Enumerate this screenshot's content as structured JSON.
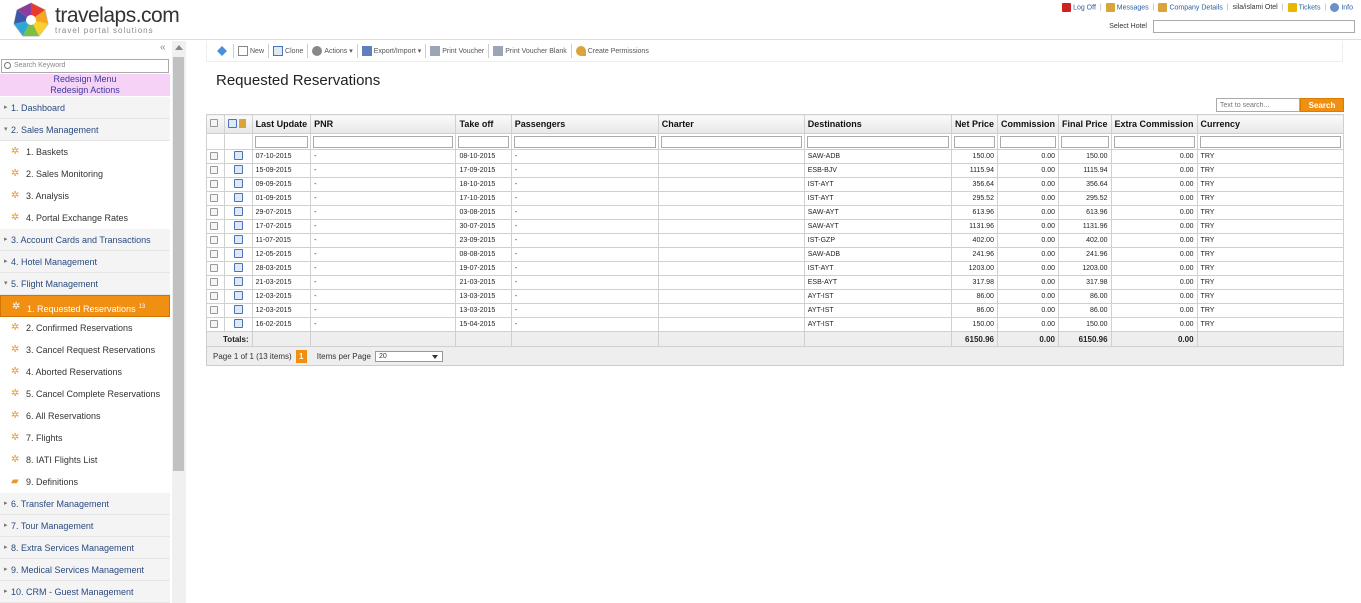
{
  "brand": {
    "name": "travelaps.com",
    "tagline": "travel portal solutions"
  },
  "toplinks": [
    {
      "label": "Log Off",
      "icon": "logoff-icon",
      "color": "#cc2222"
    },
    {
      "label": "Messages",
      "icon": "messages-icon",
      "color": "#d9a53a"
    },
    {
      "label": "Company Details",
      "icon": "company-icon",
      "color": "#d9a53a"
    },
    {
      "label": "sila/islami Otel",
      "icon": "",
      "color": ""
    },
    {
      "label": "Tickets",
      "icon": "tickets-icon",
      "color": "#e8b800"
    },
    {
      "label": "Info",
      "icon": "info-icon",
      "color": "#6b8fc9"
    }
  ],
  "select_hotel_label": "Select Hotel",
  "sidebar": {
    "search_placeholder": "Search Keyword",
    "redesign_menu": "Redesign Menu",
    "redesign_actions": "Redesign Actions",
    "items": [
      {
        "label": "1. Dashboard",
        "level": 1
      },
      {
        "label": "2. Sales Management",
        "level": 1,
        "open": true
      },
      {
        "label": "1. Baskets",
        "level": 2
      },
      {
        "label": "2. Sales Monitoring",
        "level": 2
      },
      {
        "label": "3. Analysis",
        "level": 2
      },
      {
        "label": "4. Portal Exchange Rates",
        "level": 2
      },
      {
        "label": "3. Account Cards and Transactions",
        "level": 1
      },
      {
        "label": "4. Hotel Management",
        "level": 1
      },
      {
        "label": "5. Flight Management",
        "level": 1,
        "open": true
      },
      {
        "label": "1. Requested Reservations",
        "level": 2,
        "active": true,
        "badge": "13"
      },
      {
        "label": "2. Confirmed Reservations",
        "level": 2
      },
      {
        "label": "3. Cancel Request Reservations",
        "level": 2
      },
      {
        "label": "4. Aborted Reservations",
        "level": 2
      },
      {
        "label": "5. Cancel Complete Reservations",
        "level": 2
      },
      {
        "label": "6. All Reservations",
        "level": 2
      },
      {
        "label": "7. Flights",
        "level": 2
      },
      {
        "label": "8. IATI Flights List",
        "level": 2
      },
      {
        "label": "9. Definitions",
        "level": 2
      },
      {
        "label": "6. Transfer Management",
        "level": 1
      },
      {
        "label": "7. Tour Management",
        "level": 1
      },
      {
        "label": "8. Extra Services Management",
        "level": 1
      },
      {
        "label": "9. Medical Services Management",
        "level": 1
      },
      {
        "label": "10. CRM - Guest Management",
        "level": 1
      }
    ]
  },
  "toolbar": {
    "new": "New",
    "clone": "Clone",
    "actions": "Actions",
    "export_import": "Export/Import",
    "print_voucher": "Print Voucher",
    "print_voucher_blank": "Print Voucher Blank",
    "create_permissions": "Create Permissions"
  },
  "page_title": "Requested Reservations",
  "search": {
    "placeholder": "Text to search...",
    "button": "Search"
  },
  "table": {
    "columns": [
      "Last Update",
      "PNR",
      "Take off",
      "Passengers",
      "Charter",
      "Destinations",
      "Net Price",
      "Commission",
      "Final Price",
      "Extra Commission",
      "Currency"
    ],
    "rows": [
      [
        "07-10-2015",
        "-",
        "08-10-2015",
        "-",
        "",
        "SAW-ADB",
        "150.00",
        "0.00",
        "150.00",
        "0.00",
        "TRY"
      ],
      [
        "15-09-2015",
        "-",
        "17-09-2015",
        "-",
        "",
        "ESB-BJV",
        "1115.94",
        "0.00",
        "1115.94",
        "0.00",
        "TRY"
      ],
      [
        "09-09-2015",
        "-",
        "18-10-2015",
        "-",
        "",
        "IST-AYT",
        "356.64",
        "0.00",
        "356.64",
        "0.00",
        "TRY"
      ],
      [
        "01-09-2015",
        "-",
        "17-10-2015",
        "-",
        "",
        "IST-AYT",
        "295.52",
        "0.00",
        "295.52",
        "0.00",
        "TRY"
      ],
      [
        "29-07-2015",
        "-",
        "03-08-2015",
        "-",
        "",
        "SAW-AYT",
        "613.96",
        "0.00",
        "613.96",
        "0.00",
        "TRY"
      ],
      [
        "17-07-2015",
        "-",
        "30-07-2015",
        "-",
        "",
        "SAW-AYT",
        "1131.96",
        "0.00",
        "1131.96",
        "0.00",
        "TRY"
      ],
      [
        "11-07-2015",
        "-",
        "23-09-2015",
        "-",
        "",
        "IST-GZP",
        "402.00",
        "0.00",
        "402.00",
        "0.00",
        "TRY"
      ],
      [
        "12-05-2015",
        "-",
        "08-08-2015",
        "-",
        "",
        "SAW-ADB",
        "241.96",
        "0.00",
        "241.96",
        "0.00",
        "TRY"
      ],
      [
        "28-03-2015",
        "-",
        "19-07-2015",
        "-",
        "",
        "IST-AYT",
        "1203.00",
        "0.00",
        "1203.00",
        "0.00",
        "TRY"
      ],
      [
        "21-03-2015",
        "-",
        "21-03-2015",
        "-",
        "",
        "ESB-AYT",
        "317.98",
        "0.00",
        "317.98",
        "0.00",
        "TRY"
      ],
      [
        "12-03-2015",
        "-",
        "13-03-2015",
        "-",
        "",
        "AYT-IST",
        "86.00",
        "0.00",
        "86.00",
        "0.00",
        "TRY"
      ],
      [
        "12-03-2015",
        "-",
        "13-03-2015",
        "-",
        "",
        "AYT-IST",
        "86.00",
        "0.00",
        "86.00",
        "0.00",
        "TRY"
      ],
      [
        "16-02-2015",
        "-",
        "15-04-2015",
        "-",
        "",
        "AYT-IST",
        "150.00",
        "0.00",
        "150.00",
        "0.00",
        "TRY"
      ]
    ],
    "totals_label": "Totals:",
    "totals": {
      "net_price": "6150.96",
      "commission": "0.00",
      "final_price": "6150.96",
      "extra_commission": "0.00"
    }
  },
  "pager": {
    "info": "Page 1 of 1 (13 items)",
    "current_page": "1",
    "items_per_page_label": "Items per Page",
    "items_per_page": "20"
  },
  "colors": {
    "accent": "#f18f12",
    "link": "#2a4a80",
    "redesign_bg": "#f6d3f6"
  }
}
